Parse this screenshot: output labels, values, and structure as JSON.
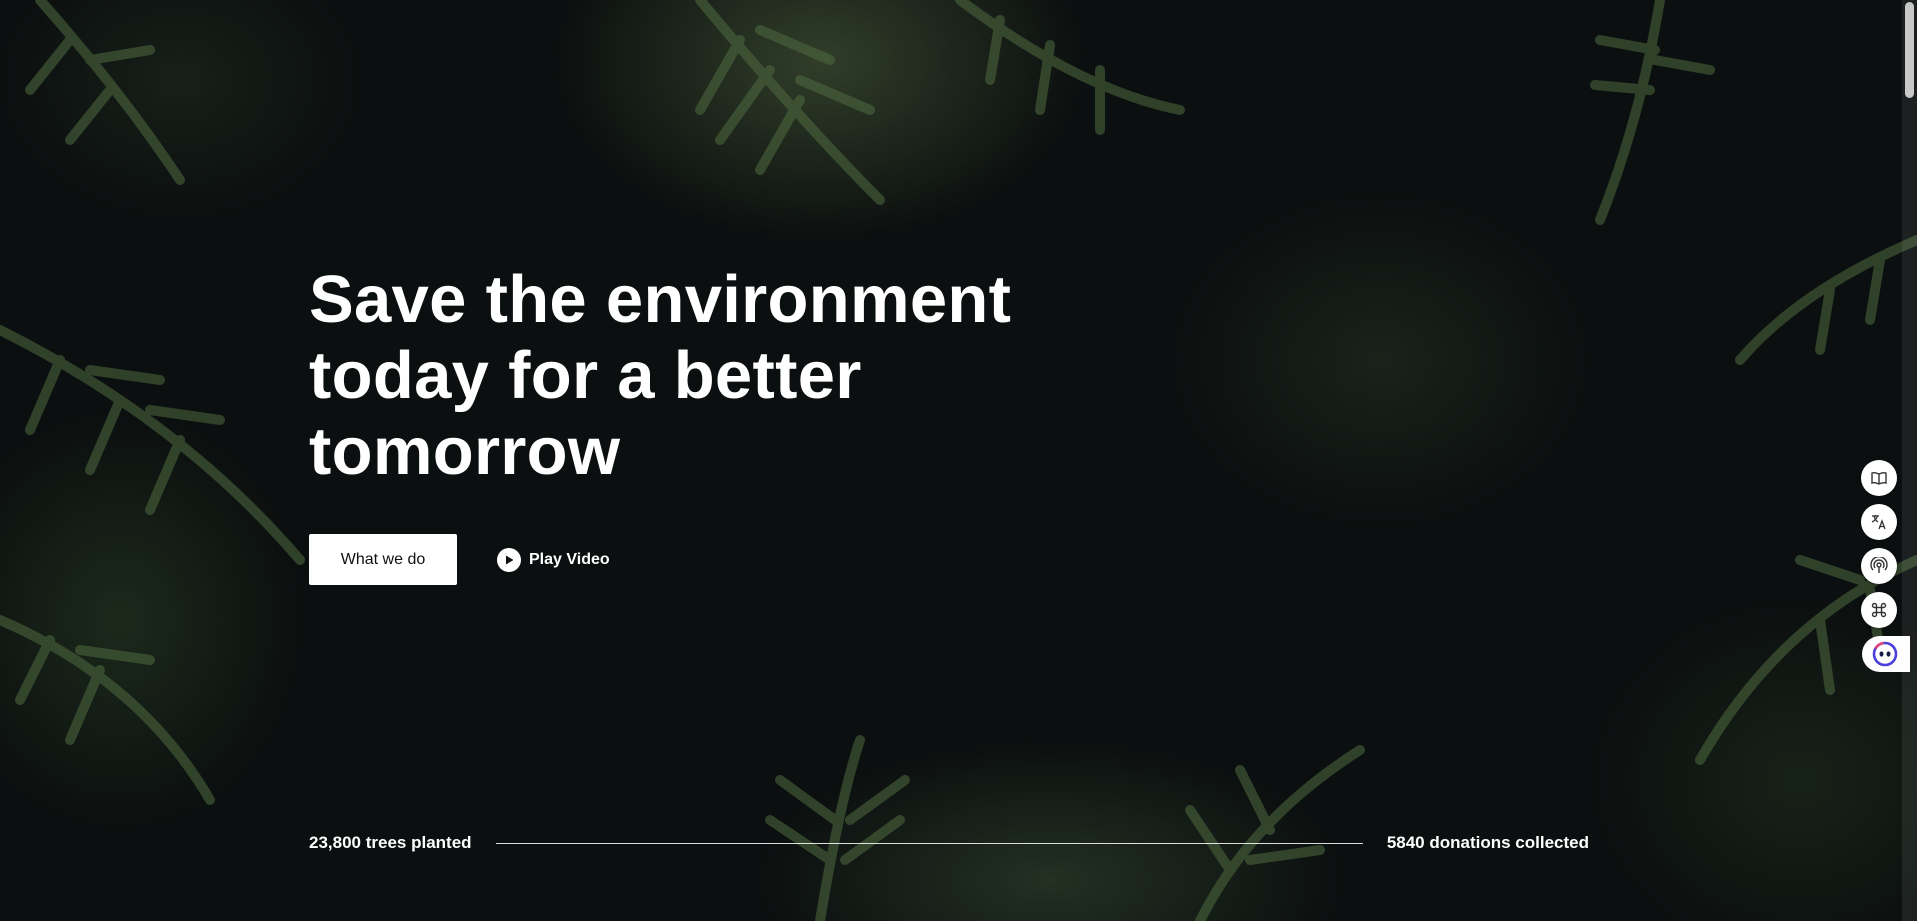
{
  "hero": {
    "headline_line1": "Save the environment",
    "headline_line2": "today for a better",
    "headline_line3": "tomorrow",
    "primary_button_label": "What we do",
    "play_label": "Play Video"
  },
  "stats": {
    "trees_planted": "23,800 trees planted",
    "donations_collected": "5840 donations collected"
  },
  "side_toolbar": {
    "items": [
      "book-icon",
      "translate-icon",
      "podcast-icon",
      "command-icon",
      "assistant-icon"
    ]
  },
  "colors": {
    "background": "#0b0f0f",
    "text": "#ffffff",
    "button_bg": "#ffffff",
    "button_text": "#111111",
    "assistant_accent": "#4a3fd8"
  }
}
